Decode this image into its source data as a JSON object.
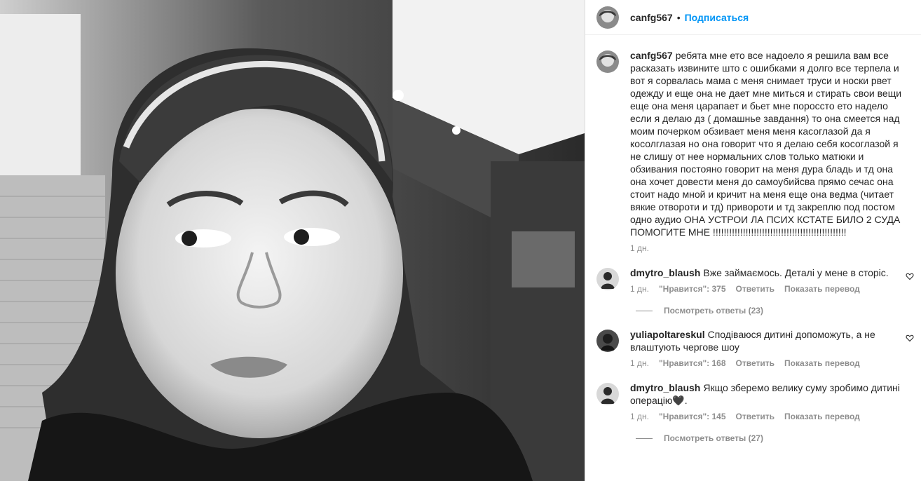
{
  "post": {
    "username": "canfg567",
    "follow_label": "Подписаться",
    "separator": "•",
    "caption": "ребята мне ето все надоело я решила вам все расказать извините што с ошибками я долго все терпела и вот я сорвалась мама с меня снимает труси и носки рвет одежду и еще она не дает мне миться и стирать свои вещи еще она меня царапает и бьет мне пороссто ето надело если я делаю дз ( домашнье завдання) то она смеется над моим почерком обзивает меня меня касоглазой да я косолглазая но она говорит что я делаю себя косоглазой я не слишу от нее нормальних слов только матюки и обзивания постояно говорит на меня дура бладь и тд она она хочет довести меня до самоубийсва прямо сечас она стоит надо мной и кричит на меня еще она ведма (читает вякие отвороти и тд) привороти и тд закреплю под постом одно аудио ОНА УСТРОИ ЛА ПСИХ КСТАТЕ БИЛО 2 СУДА ПОМОГИТЕ МНЕ !!!!!!!!!!!!!!!!!!!!!!!!!!!!!!!!!!!!!!!!!!!!!!!!!",
    "time": "1 дн."
  },
  "comments": [
    {
      "username": "dmytro_blaush",
      "text": "Вже займаємось. Деталі у мене в сторіс.",
      "time": "1 дн.",
      "likes": "\"Нравится\": 375",
      "reply": "Ответить",
      "translate": "Показать перевод",
      "view_replies": "Посмотреть ответы (23)"
    },
    {
      "username": "yuliapoltareskul",
      "text": "Сподіваюся дитині допоможуть, а не влаштують чергове шоу",
      "time": "1 дн.",
      "likes": "\"Нравится\": 168",
      "reply": "Ответить",
      "translate": "Показать перевод",
      "view_replies": ""
    },
    {
      "username": "dmytro_blaush",
      "text": "Якщо зберемо велику суму зробимо дитині операцію🖤.",
      "time": "1 дн.",
      "likes": "\"Нравится\": 145",
      "reply": "Ответить",
      "translate": "Показать перевод",
      "view_replies": "Посмотреть ответы (27)"
    }
  ],
  "icons": {
    "heart": "heart-outline-icon"
  },
  "colors": {
    "accent": "#0095f6",
    "secondary_text": "#8e8e8e",
    "primary_text": "#262626"
  }
}
